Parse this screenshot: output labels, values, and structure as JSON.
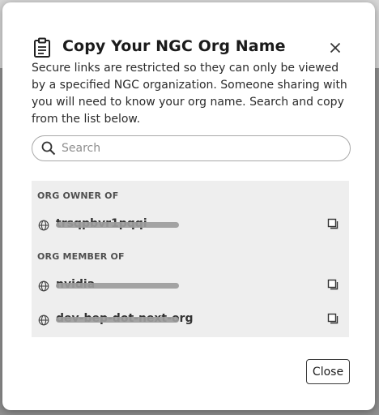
{
  "modal": {
    "title": "Copy Your NGC Org Name",
    "description": "Secure links are restricted so they can only be viewed by a specified NGC organization. Someone sharing with you will need to know your org name. Search and copy from the list below.",
    "search": {
      "placeholder": "Search",
      "value": ""
    },
    "sections": [
      {
        "label": "ORG OWNER OF",
        "orgs": [
          {
            "name": "trsqpbvr1pqqi"
          }
        ]
      },
      {
        "label": "ORG MEMBER OF",
        "orgs": [
          {
            "name": "nvidia"
          },
          {
            "name": "dev-bep-dot-next-org"
          }
        ]
      }
    ],
    "close_label": "Close"
  },
  "icons": {
    "header": "clipboard-icon",
    "close": "close-icon",
    "search": "search-icon",
    "org": "globe-icon",
    "copy": "copy-icon"
  },
  "colors": {
    "list_background": "#eeeeee",
    "redaction": "#9c9c9c",
    "text": "#1b1b1b"
  }
}
